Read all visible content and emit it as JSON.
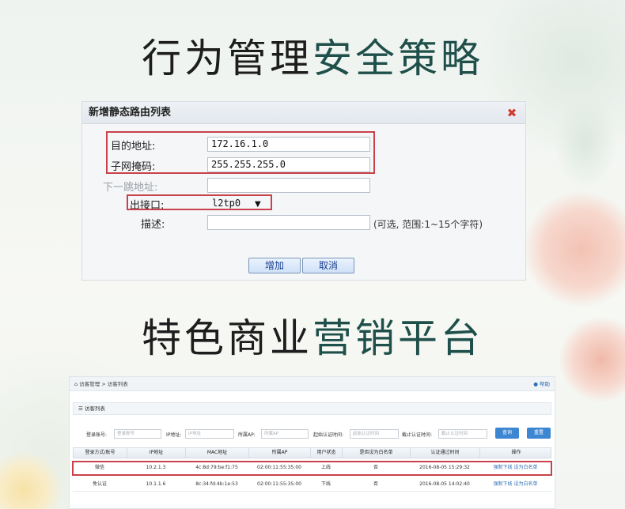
{
  "headings": {
    "top": {
      "dark": "行为管理",
      "green": "安全策略"
    },
    "bottom": {
      "dark": "特色商业",
      "green": "营销平台"
    }
  },
  "colors": {
    "heading_dark": "#1d1d1d",
    "heading_green": "#1f4f4a",
    "highlight_red": "#c9414a",
    "link_blue": "#2f6fb5",
    "button_blue": "#3d86d1"
  },
  "dialog": {
    "title": "新增静态路由列表",
    "close_icon": "close-icon",
    "fields": {
      "dest_label": "目的地址:",
      "dest_value": "172.16.1.0",
      "mask_label": "子网掩码:",
      "mask_value": "255.255.255.0",
      "gateway_label": "下一跳地址:",
      "gateway_value": "",
      "iface_label": "出接口:",
      "iface_value": "l2tp0",
      "desc_label": "描述:",
      "desc_value": "",
      "desc_hint": "(可选, 范围:1~15个字符)"
    },
    "buttons": {
      "add": "增加",
      "cancel": "取消"
    }
  },
  "visitor_panel": {
    "breadcrumb": "访客管理 > 访客列表",
    "help": "帮助",
    "subtitle": "访客列表",
    "filters": {
      "account_label": "登录账号:",
      "account_placeholder": "登录账号",
      "ip_label": "IP地址:",
      "ip_placeholder": "IP地址",
      "ap_label": "所属AP:",
      "ap_placeholder": "所属AP",
      "start_label": "起始认证时间:",
      "start_placeholder": "起始认证时间",
      "end_label": "截止认证时间:",
      "end_placeholder": "截止认证时间",
      "query_button": "查询",
      "reset_button": "重置"
    },
    "table": {
      "headers": [
        "登录方式/账号",
        "IP地址",
        "MAC地址",
        "所属AP",
        "用户状态",
        "是否设为白名单",
        "认证通过时间",
        "操作"
      ],
      "rows": [
        [
          "微信",
          "10.2.1.3",
          "4c:8d:79:be:f1:75",
          "02:00:11:55:35:00",
          "上线",
          "否",
          "2016-08-05 15:29:32",
          "强制下线 设为白名单"
        ],
        [
          "免认证",
          "10.1.1.6",
          "8c:34:fd:4b:1e:53",
          "02:00:11:55:35:00",
          "下线",
          "否",
          "2016-08-05 14:02:40",
          "强制下线 设为白名单"
        ]
      ]
    }
  }
}
